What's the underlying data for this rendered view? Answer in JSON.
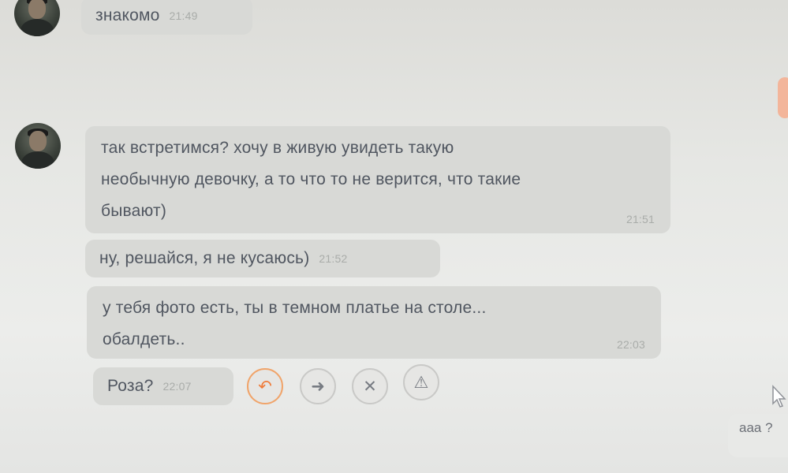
{
  "messages": [
    {
      "text": "знакомо",
      "time": "21:49"
    },
    {
      "text": "так встретимся? хочу в живую увидеть такую\nнеобычную девочку, а то что то не верится, что такие\nбывают)",
      "time": "21:51"
    },
    {
      "text": "ну, решайся, я не кусаюсь)",
      "time": "21:52"
    },
    {
      "text": "у тебя фото есть, ты в темном платье на столе...\nобалдеть..",
      "time": "22:03"
    },
    {
      "text": "Роза?",
      "time": "22:07"
    }
  ],
  "actions": [
    {
      "icon": "reply-icon",
      "glyph": "↶"
    },
    {
      "icon": "forward-icon",
      "glyph": "➜"
    },
    {
      "icon": "delete-icon",
      "glyph": "✕"
    },
    {
      "icon": "report-icon",
      "glyph": "⚠"
    }
  ],
  "outgoing": {
    "text": "ааа ?"
  },
  "colors": {
    "bubble": "#d8d9d6",
    "accent": "#ef7c3b"
  }
}
